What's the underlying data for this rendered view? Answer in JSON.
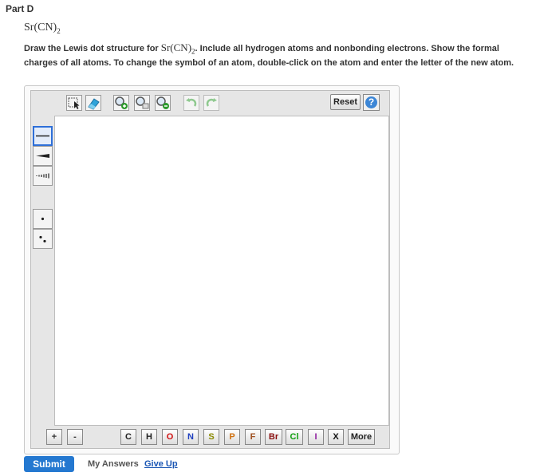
{
  "part_title": "Part D",
  "formula": {
    "base": "Sr(CN)",
    "sub": "2"
  },
  "instructions": {
    "pre": "Draw the Lewis dot structure for ",
    "formula_base": "Sr(CN)",
    "formula_sub": "2",
    "post": ". Include all hydrogen atoms and nonbonding electrons. Show the formal charges of all atoms. To change the symbol of an atom, double-click on the atom and enter the letter of the new atom."
  },
  "toolbar": {
    "reset_label": "Reset",
    "help_label": "?"
  },
  "zoom": {
    "plus": "+",
    "minus": "-"
  },
  "atoms": [
    {
      "symbol": "C",
      "color": "#222222"
    },
    {
      "symbol": "H",
      "color": "#222222"
    },
    {
      "symbol": "O",
      "color": "#d01010"
    },
    {
      "symbol": "N",
      "color": "#2040c0"
    },
    {
      "symbol": "S",
      "color": "#8a8a00"
    },
    {
      "symbol": "P",
      "color": "#d07010"
    },
    {
      "symbol": "F",
      "color": "#a05020"
    },
    {
      "symbol": "Br",
      "color": "#8b1010"
    },
    {
      "symbol": "Cl",
      "color": "#10a010"
    },
    {
      "symbol": "I",
      "color": "#9020a0"
    },
    {
      "symbol": "X",
      "color": "#111111"
    }
  ],
  "more_label": "More",
  "actions": {
    "submit": "Submit",
    "my_answers": "My Answers",
    "give_up": "Give Up"
  },
  "colors": {
    "accent": "#2478d0",
    "link": "#1a56b4"
  }
}
